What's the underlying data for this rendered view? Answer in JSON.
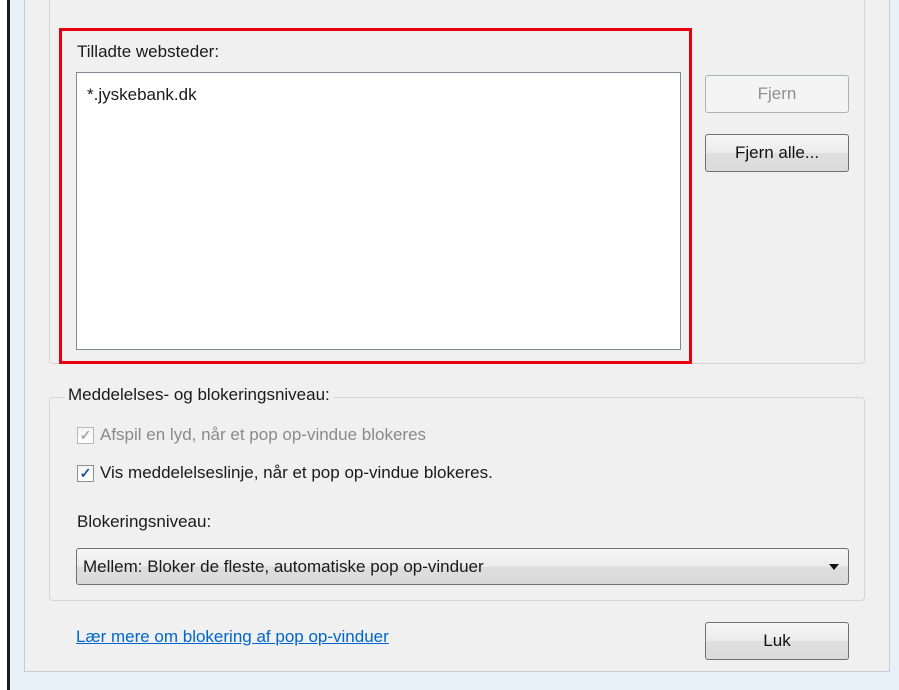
{
  "allowed_sites": {
    "label": "Tilladte websteder:",
    "items": [
      "*.jyskebank.dk"
    ]
  },
  "buttons": {
    "remove": "Fjern",
    "remove_all": "Fjern alle...",
    "close": "Luk"
  },
  "notification": {
    "legend": "Meddelelses- og blokeringsniveau:",
    "play_sound": {
      "label": "Afspil en lyd, når et pop op-vindue blokeres",
      "checked": true,
      "enabled": false
    },
    "show_bar": {
      "label": "Vis meddelelseslinje, når et pop op-vindue blokeres.",
      "checked": true,
      "enabled": true
    },
    "level_label": "Blokeringsniveau:",
    "level_value": "Mellem: Bloker de fleste, automatiske pop op-vinduer"
  },
  "footer": {
    "learn_more_link": "Lær mere om blokering af pop op-vinduer"
  },
  "colors": {
    "highlight": "#e8000e",
    "link": "#0066cc",
    "background": "#e8f0f8"
  },
  "icons": {
    "check": "check-icon",
    "dropdown": "chevron-down-icon"
  }
}
